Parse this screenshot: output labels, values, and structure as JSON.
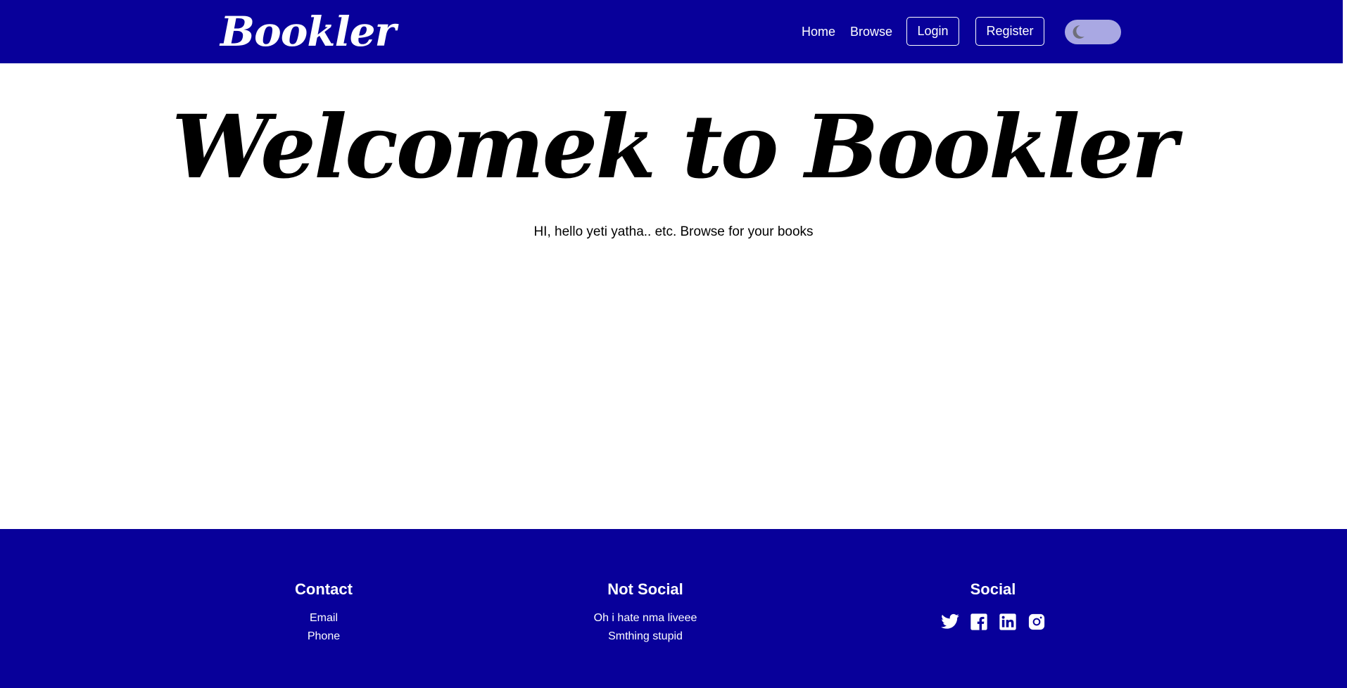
{
  "navbar": {
    "brand": "Bookler",
    "links": [
      "Home",
      "Browse"
    ],
    "login_label": "Login",
    "register_label": "Register",
    "theme_toggle_icon": "moon-icon",
    "bg_color": "#08009a"
  },
  "hero": {
    "title": "Welcomek to Bookler",
    "subtitle": "HI, hello yeti yatha.. etc. Browse for your books"
  },
  "footer": {
    "bg_color": "#08009a",
    "contact": {
      "heading": "Contact",
      "items": [
        "Email",
        "Phone"
      ]
    },
    "not_social": {
      "heading": "Not Social",
      "items": [
        "Oh i hate nma liveee",
        "Smthing stupid"
      ]
    },
    "social": {
      "heading": "Social",
      "icons": [
        "twitter-icon",
        "facebook-icon",
        "linkedin-icon",
        "instagram-icon"
      ]
    }
  }
}
